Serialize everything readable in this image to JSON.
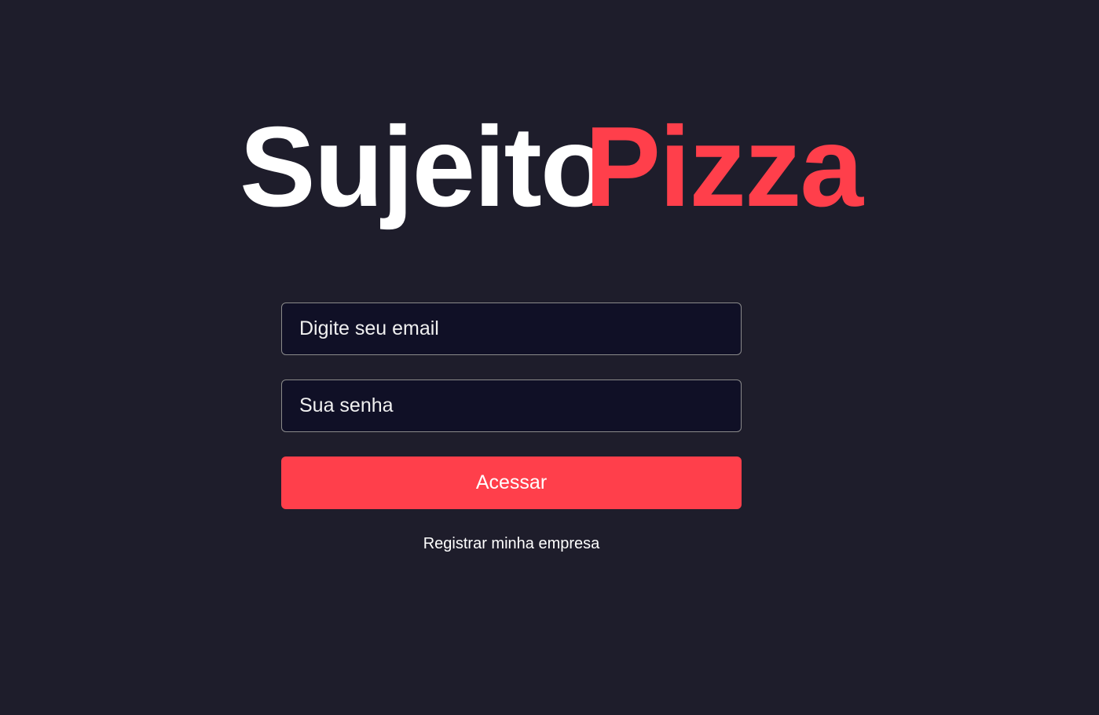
{
  "logo": {
    "part1": "Sujeito",
    "part2": "Pizza"
  },
  "form": {
    "email_placeholder": "Digite seu email",
    "password_placeholder": "Sua senha",
    "submit_label": "Acessar",
    "register_link": "Registrar minha empresa"
  },
  "colors": {
    "background": "#1e1d2b",
    "input_background": "#101026",
    "accent": "#ff3f4b",
    "text": "#ffffff",
    "input_border": "#8a8a8a"
  }
}
